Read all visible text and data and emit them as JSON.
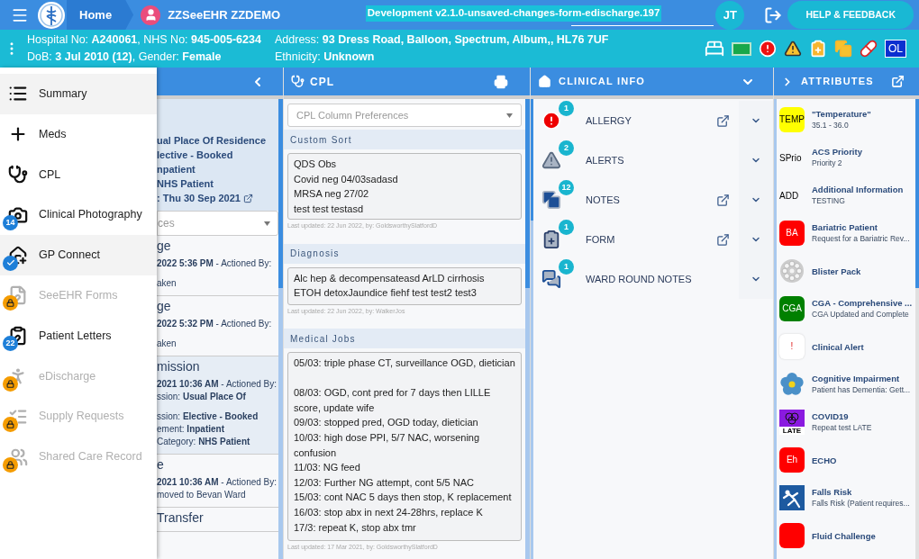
{
  "topbar": {
    "home": "Home",
    "patient": "ZZSeeEHR ZZDEMO",
    "environment": "Development v2.1.0-unsaved-changes-form-edischarge.197",
    "user_initials": "JT",
    "help": "HELP & FEEDBACK"
  },
  "patient_banner": {
    "columns": [
      [
        "Hospital No: **A240061**, NHS No: **945-005-6234**",
        "DoB: **3 Jul 2010 (12)**, Gender: **Female**"
      ],
      [
        "Address: **93 Dress Road, Balloon, Spectrum, Album,, HL76 7UF**",
        "Ethnicity: **Unknown**"
      ]
    ],
    "status_icons": [
      {
        "kind": "bed"
      },
      {
        "kind": "green_flag"
      },
      {
        "kind": "allergy"
      },
      {
        "kind": "warning"
      },
      {
        "kind": "clipboard"
      },
      {
        "kind": "copies"
      },
      {
        "kind": "pill"
      },
      {
        "kind": "text",
        "text": "OL"
      }
    ]
  },
  "menu": [
    {
      "label": "Summary",
      "kind": "summary",
      "highlighted": true,
      "disabled": false
    },
    {
      "label": "Meds",
      "kind": "meds",
      "highlighted": false,
      "disabled": false
    },
    {
      "label": "CPL",
      "kind": "cpl",
      "highlighted": false,
      "disabled": false
    },
    {
      "label": "Clinical Photography",
      "kind": "photo",
      "highlighted": false,
      "disabled": false,
      "badge": {
        "kind": "count",
        "text": "14"
      }
    },
    {
      "label": "GP Connect",
      "kind": "gp",
      "highlighted": true,
      "disabled": false,
      "badge": {
        "kind": "check"
      }
    },
    {
      "label": "SeeEHR Forms",
      "kind": "forms",
      "highlighted": false,
      "disabled": true,
      "badge": {
        "kind": "lock"
      }
    },
    {
      "label": "Patient Letters",
      "kind": "letters",
      "highlighted": false,
      "disabled": false,
      "badge": {
        "kind": "count",
        "text": "22"
      }
    },
    {
      "label": "eDischarge",
      "kind": "discharge",
      "highlighted": false,
      "disabled": true,
      "badge": {
        "kind": "lock"
      }
    },
    {
      "label": "Supply Requests",
      "kind": "supply",
      "highlighted": false,
      "disabled": true,
      "badge": {
        "kind": "lock"
      }
    },
    {
      "label": "Shared Care Record",
      "kind": "shared",
      "highlighted": false,
      "disabled": true,
      "badge": {
        "kind": "lock"
      }
    }
  ],
  "history_panel": {
    "card": [
      "ual Place Of Residence",
      "lective - Booked",
      "npatient",
      "NHS Patient",
      ": Thu 30 Sep 2021"
    ],
    "filter_placeholder": "ces",
    "entries": [
      {
        "title": "ge",
        "highlighted": false,
        "paragraphs": [
          [
            "**2022 5:36 PM** - Actioned By:"
          ],
          [
            "aken"
          ]
        ]
      },
      {
        "title": "ge",
        "highlighted": false,
        "paragraphs": [
          [
            "**2022 5:32 PM** - Actioned By:"
          ],
          [
            "aken"
          ]
        ]
      },
      {
        "title": "mission",
        "highlighted": true,
        "paragraphs": [
          [
            "**2021 10:36 AM** - Actioned By:",
            "ssion: **Usual Place Of**"
          ],
          [
            "ssion: **Elective - Booked**",
            "ement: **Inpatient**",
            "Category: **NHS Patient**"
          ]
        ]
      },
      {
        "title": "e",
        "highlighted": false,
        "paragraphs": [
          [
            "**2021 10:36 AM** - Actioned By:",
            "moved to Bevan Ward"
          ]
        ]
      },
      {
        "title": "Transfer",
        "highlighted": false
      }
    ]
  },
  "cpl": {
    "title": "CPL",
    "preferences_placeholder": "CPL Column Preferences",
    "sections": [
      {
        "title": "Custom Sort",
        "text": "QDS Obs\nCovid neg 04/03sadasd\nMRSA neg 27/02\ntest test testasd",
        "updated": "Last updated: 22 Jun 2022, by: GoldsworthySlatfordD"
      },
      {
        "title": "Diagnosis",
        "text": "Alc hep & decompensateasd ArLD cirrhosis\nETOH detoxJaundice fiehf test test2 test3",
        "updated": "Last updated: 22 Jun 2022, by: WalkerJos"
      },
      {
        "title": "Medical Jobs",
        "text": "05/03: triple phase CT, surveillance OGD, dietician\n\n08/03: OGD, cont pred for 7 days then LILLE score, update wife\n09/03: stopped pred, OGD today, dietician\n10/03: high dose PPI, 5/7 NAC, worsening confusion\n11/03: NG feed\n12/03: Further NG attempt, cont 5/5 NAC\n15/03: cont NAC 5 days then stop, K replacement\n16/03: stop abx in next 24-28hrs, replace K\n17/3: repeat K, stop abx tmr",
        "updated": "Last updated: 17 Mar 2021, by: GoldsworthySlatfordD"
      }
    ]
  },
  "clinical_info": {
    "title": "CLINICAL INFO",
    "items": [
      {
        "label": "ALLERGY",
        "kind": "allergy",
        "count": "1",
        "link": true
      },
      {
        "label": "ALERTS",
        "kind": "alerts",
        "count": "2",
        "link": false
      },
      {
        "label": "NOTES",
        "kind": "notes",
        "count": "12",
        "link": true
      },
      {
        "label": "FORM",
        "kind": "form",
        "count": "1",
        "link": true
      },
      {
        "label": "WARD ROUND NOTES",
        "kind": "ward_round",
        "count": "1",
        "link": false
      }
    ]
  },
  "attributes": {
    "title": "ATTRIBUTES",
    "items": [
      {
        "title": "\"Temperature\"",
        "subtitle": "35.1 - 36.0",
        "kind": "tile",
        "icon_text": "TEMP",
        "color": "#ffff00"
      },
      {
        "title": "ACS Priority",
        "subtitle": "Priority 2",
        "kind": "label",
        "icon_text": "SPrio"
      },
      {
        "title": "Additional Information",
        "subtitle": "TESTING",
        "kind": "label",
        "icon_text": "ADD"
      },
      {
        "title": "Bariatric Patient",
        "subtitle": "Request for a Bariatric Rev...",
        "kind": "tile",
        "icon_text": "BA",
        "color": "#ff0000"
      },
      {
        "title": "Blister Pack",
        "kind": "blister"
      },
      {
        "title": "CGA - Comprehensive ...",
        "subtitle": "CGA Updated and Complete",
        "kind": "tile",
        "icon_text": "CGA",
        "color": "#008000"
      },
      {
        "title": "Clinical Alert",
        "kind": "tile",
        "icon_text": "!",
        "color": "#ffffff"
      },
      {
        "title": "Cognitive Impairment",
        "subtitle": "Patient has Dementia: Gett...",
        "kind": "flower"
      },
      {
        "title": "COVID19",
        "subtitle": "Repeat test LATE",
        "kind": "covid",
        "icon_text": "LATE"
      },
      {
        "title": "ECHO",
        "kind": "tile",
        "icon_text": "Eh",
        "color": "#ff0000"
      },
      {
        "title": "Falls Risk",
        "subtitle": "Falls Risk (Patient requires...",
        "kind": "falls"
      },
      {
        "title": "Fluid Challenge",
        "kind": "tile",
        "color": "#ff0000"
      }
    ]
  }
}
